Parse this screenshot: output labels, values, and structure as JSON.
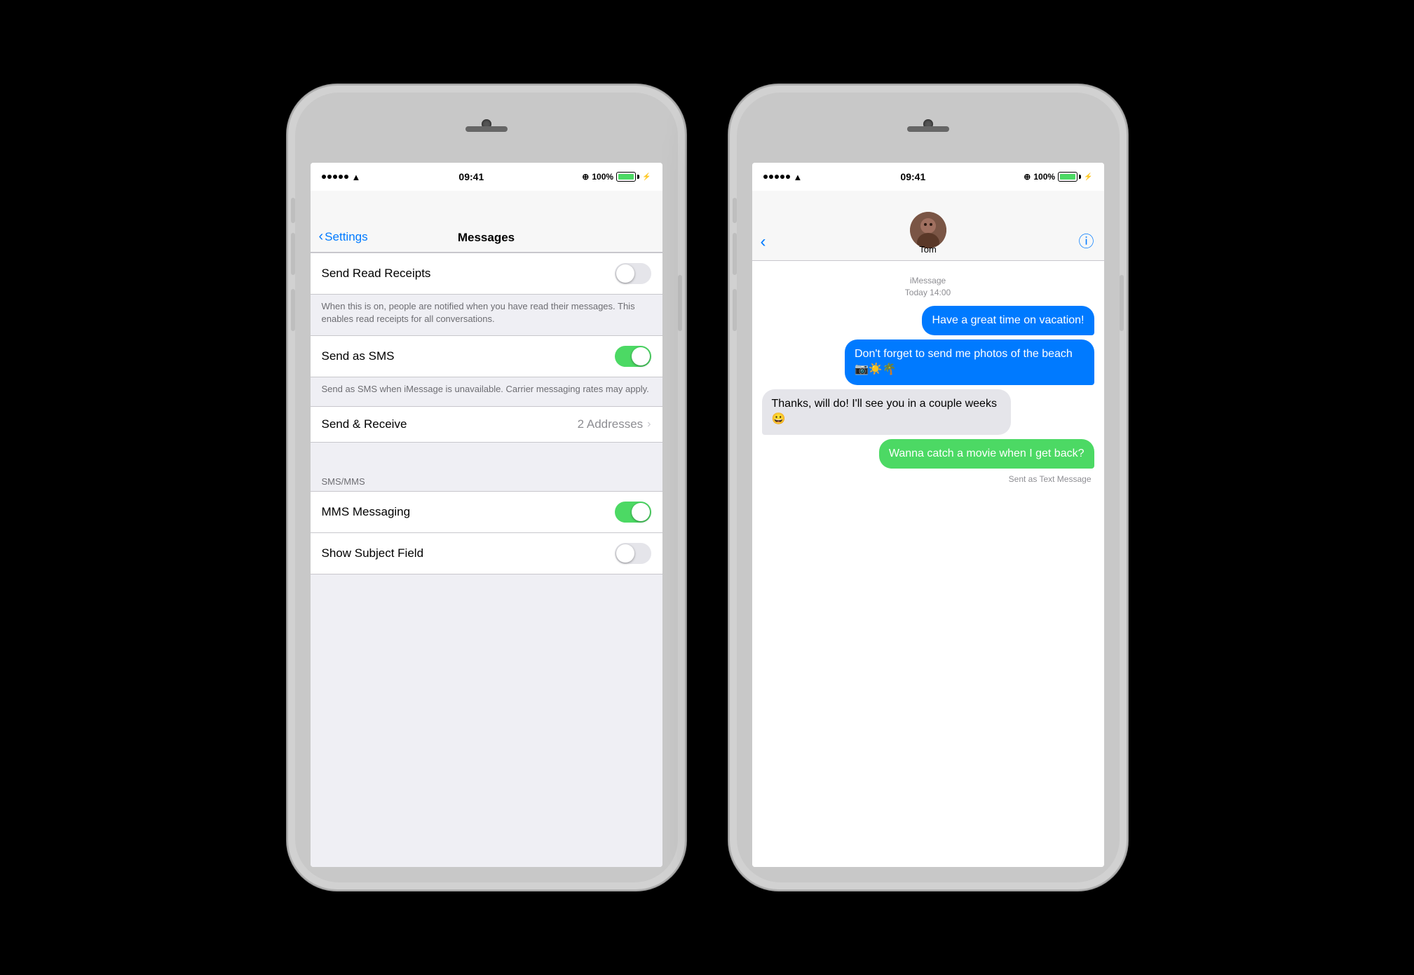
{
  "phone1": {
    "time": "09:41",
    "battery": "100%",
    "nav": {
      "back_label": "Settings",
      "title": "Messages"
    },
    "sections": [
      {
        "rows": [
          {
            "label": "Send Read Receipts",
            "toggle": "off",
            "description": "When this is on, people are notified when you have read their messages. This enables read receipts for all conversations."
          }
        ]
      },
      {
        "rows": [
          {
            "label": "Send as SMS",
            "toggle": "on",
            "description": "Send as SMS when iMessage is unavailable. Carrier messaging rates may apply."
          }
        ]
      },
      {
        "rows": [
          {
            "label": "Send & Receive",
            "value": "2 Addresses"
          }
        ]
      },
      {
        "header": "SMS/MMS",
        "rows": [
          {
            "label": "MMS Messaging",
            "toggle": "on"
          },
          {
            "label": "Show Subject Field",
            "toggle": "off"
          }
        ]
      }
    ]
  },
  "phone2": {
    "time": "09:41",
    "battery": "100%",
    "contact": {
      "name": "Tom"
    },
    "messages": {
      "date_label": "iMessage\nToday 14:00",
      "bubbles": [
        {
          "type": "sent-blue",
          "text": "Have a great time on vacation!"
        },
        {
          "type": "sent-blue",
          "text": "Don't forget to send me photos of the beach 📷☀️🌴"
        },
        {
          "type": "received-gray",
          "text": "Thanks, will do! I'll see you in a couple weeks 😀"
        },
        {
          "type": "sent-green",
          "text": "Wanna catch a movie when I get back?",
          "sent_label": "Sent as Text Message"
        }
      ]
    }
  }
}
